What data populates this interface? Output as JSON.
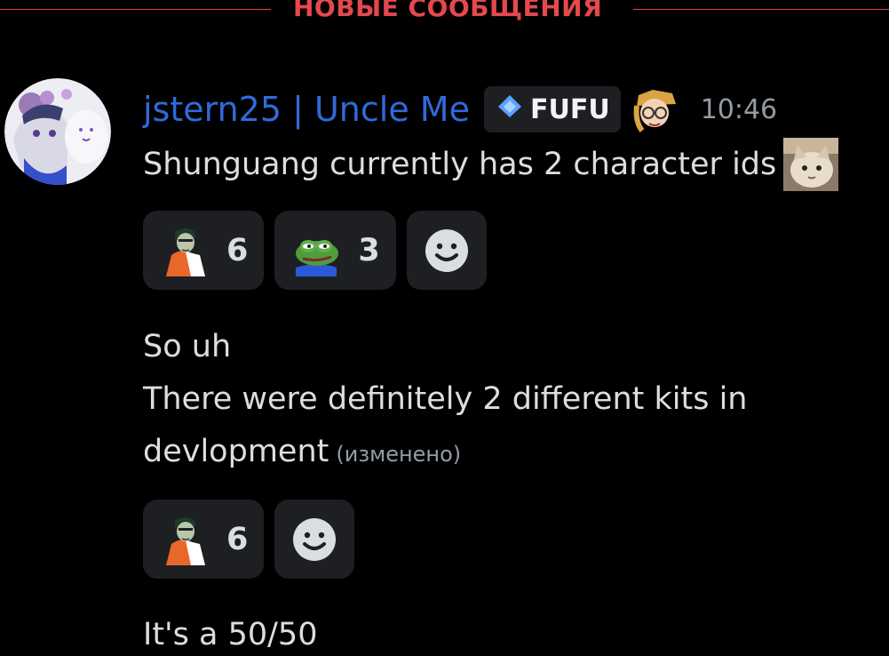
{
  "divider": {
    "label": "НОВЫЕ СООБЩЕНИЯ"
  },
  "message": {
    "username": "jstern25 | Uncle Me",
    "tag": "FUFU",
    "timestamp": "10:46",
    "lines": [
      {
        "text": "Shunguang currently has 2 character ids"
      },
      {
        "text": "So uh"
      },
      {
        "text": "There were definitely 2 different kits in"
      },
      {
        "text": "devlopment",
        "edited": "(изменено)"
      },
      {
        "text": "It's a 50/50"
      }
    ],
    "reactions_1": [
      {
        "emoji": "orange-robed-person-emoji",
        "count": "6"
      },
      {
        "emoji": "pepe-frog-emoji",
        "count": "3"
      }
    ],
    "reactions_2": [
      {
        "emoji": "orange-robed-person-emoji",
        "count": "6"
      }
    ]
  },
  "colors": {
    "background": "#000000",
    "new_divider": "#e5484d",
    "username": "#2f6bd8",
    "reaction_bg": "#1e1f22",
    "text": "#dbdee1",
    "muted": "#949ba4"
  }
}
